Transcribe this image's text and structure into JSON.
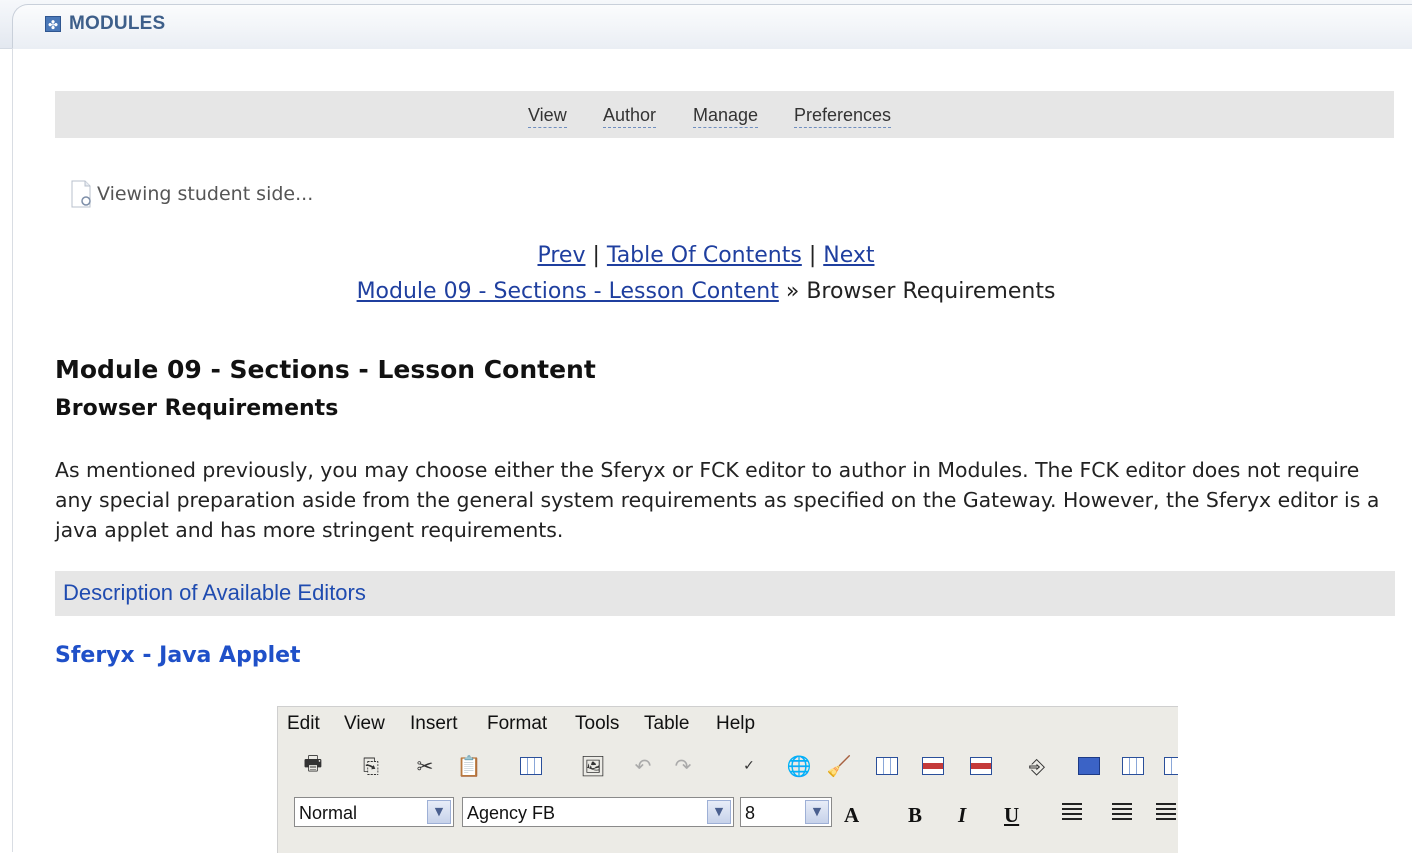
{
  "portlet": {
    "title": "MODULES",
    "icon": "modules-icon"
  },
  "nav": {
    "items": [
      "View",
      "Author",
      "Manage",
      "Preferences"
    ]
  },
  "status": {
    "viewing": "Viewing student side..."
  },
  "navlinks": {
    "prev": "Prev",
    "sep": "|",
    "toc": "Table Of Contents",
    "next": "Next",
    "module_link": "Module 09 - Sections - Lesson Content",
    "crumb_sep": "»",
    "current": "Browser Requirements"
  },
  "content": {
    "module_title": "Module 09 - Sections - Lesson Content",
    "section_title": "Browser Requirements",
    "paragraph": "As mentioned previously, you may choose either the Sferyx or FCK editor to author in Modules. The FCK editor does not require any special preparation aside from the general system requirements as specified on the Gateway. However, the Sferyx editor is a java applet and has more stringent requirements.",
    "description_bar": "Description of Available Editors",
    "sferyx_heading": "Sferyx - Java Applet"
  },
  "editor": {
    "menu": [
      "Edit",
      "View",
      "Insert",
      "Format",
      "Tools",
      "Table",
      "Help"
    ],
    "style_value": "Normal",
    "font_value": "Agency FB",
    "size_value": "8",
    "bold": "B",
    "italic": "I",
    "underline": "U",
    "grow_font": "A"
  },
  "colors": {
    "link": "#1f3f9f",
    "heading_blue": "#1f50c8",
    "bar_gray": "#e6e6e6",
    "portlet_title": "#3e5f8a"
  }
}
